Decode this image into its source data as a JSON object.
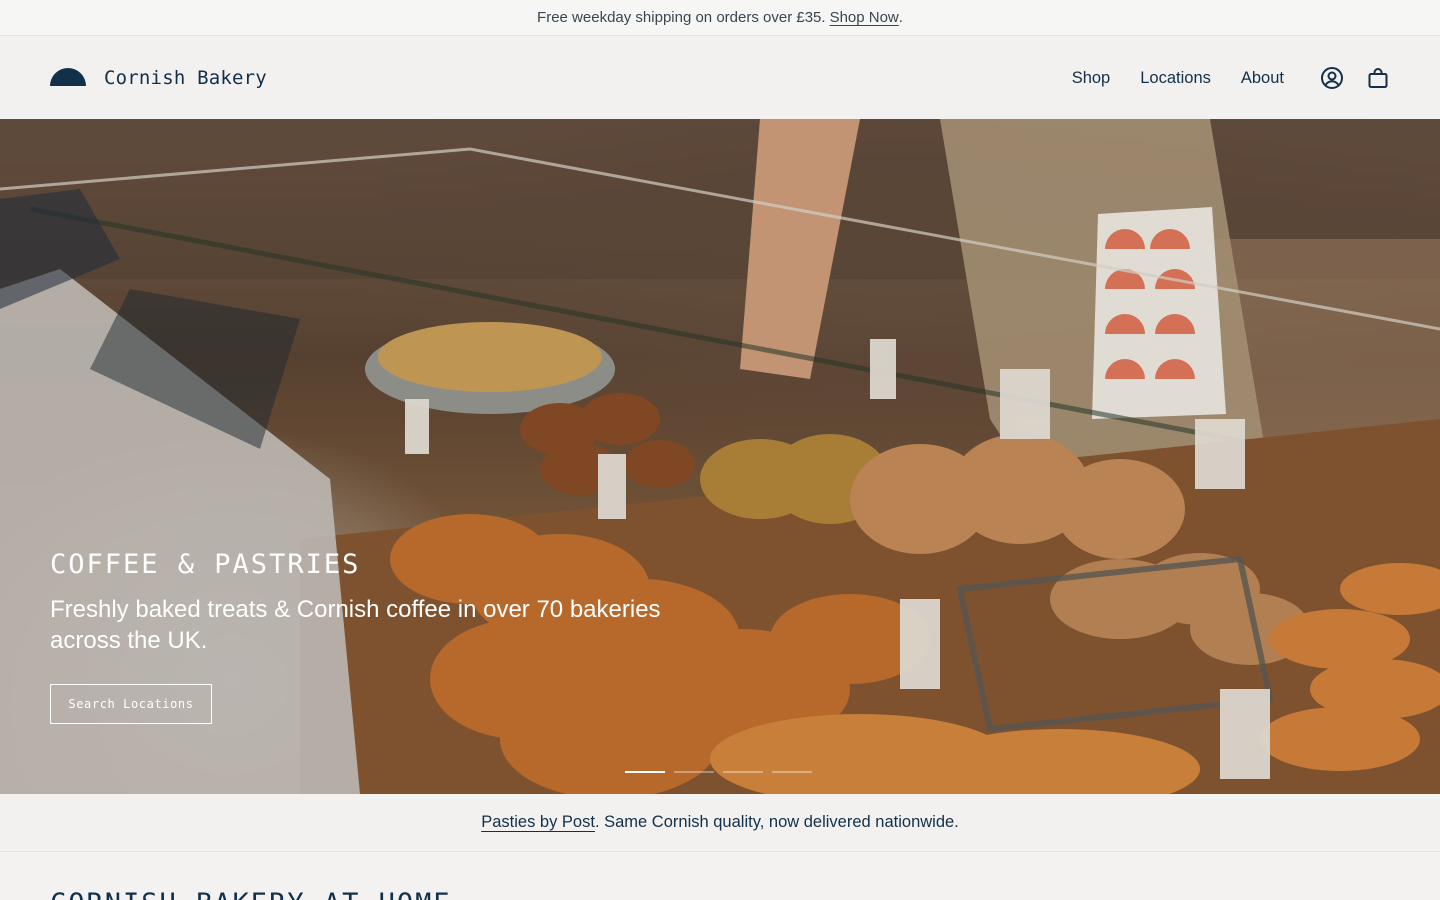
{
  "announcement": {
    "text": "Free weekday shipping on orders over £35.",
    "link_label": "Shop Now",
    "trailing": "."
  },
  "header": {
    "brand_name": "Cornish Bakery",
    "nav": [
      {
        "label": "Shop"
      },
      {
        "label": "Locations"
      },
      {
        "label": "About"
      }
    ],
    "icons": [
      "account-icon",
      "bag-icon"
    ]
  },
  "hero": {
    "eyebrow": "COFFEE & PASTRIES",
    "subtitle": "Freshly baked treats & Cornish coffee in over 70 bakeries across the UK.",
    "button_label": "Search Locations",
    "slides_total": 4,
    "active_slide": 1
  },
  "promo": {
    "link_label": "Pasties by Post",
    "text": ". Same Cornish quality, now delivered nationwide."
  },
  "section": {
    "title": "CORNISH BAKERY AT HOME"
  },
  "colors": {
    "brand": "#13304a",
    "background": "#f2f1ef",
    "hero_text": "#ffffff"
  }
}
